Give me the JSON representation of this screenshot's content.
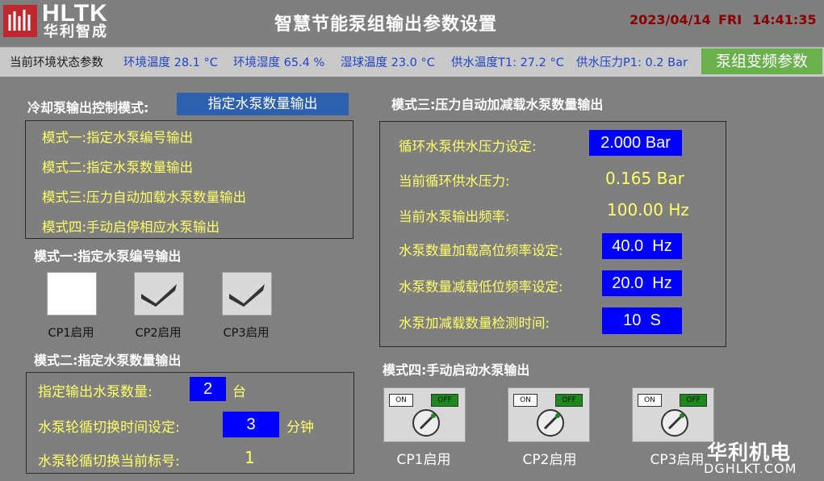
{
  "header": {
    "logo_text": "HLTK",
    "logo_cn": "华利智成",
    "title": "智慧节能泵组输出参数设置",
    "date": "2023/04/14",
    "weekday": "FRI",
    "time": "14:41:35"
  },
  "status": {
    "label": "当前环境状态参数",
    "items": [
      "环境温度 28.1 °C",
      "环境湿度 65.4 %",
      "湿球温度 23.0 °C",
      "供水温度T1: 27.2 °C",
      "供水压力P1: 0.2 Bar"
    ],
    "vfd_button": "泵组变频参数"
  },
  "control_mode": {
    "label": "冷却泵输出控制模式:",
    "selected": "指定水泵数量输出",
    "modes": [
      "模式一:指定水泵编号输出",
      "模式二:指定水泵数量输出",
      "模式三:压力自动加载水泵数量输出",
      "模式四:手动启停相应水泵输出"
    ]
  },
  "mode1": {
    "title": "模式一:指定水泵编号输出",
    "pumps": [
      {
        "label": "CP1启用",
        "checked": false
      },
      {
        "label": "CP2启用",
        "checked": true
      },
      {
        "label": "CP3启用",
        "checked": true
      }
    ]
  },
  "mode2": {
    "title": "模式二:指定水泵数量输出",
    "count_label": "指定输出水泵数量:",
    "count_value": "2",
    "count_unit": "台",
    "rotate_label": "水泵轮循切换时间设定:",
    "rotate_value": "3",
    "rotate_unit": "分钟",
    "current_label": "水泵轮循切换当前标号:",
    "current_value": "1"
  },
  "mode3": {
    "title": "模式三:压力自动加减载水泵数量输出",
    "rows": [
      {
        "label": "循环水泵供水压力设定:",
        "value": "2.000 Bar",
        "editable": true
      },
      {
        "label": "当前循环供水压力:",
        "value": "0.165 Bar",
        "editable": false
      },
      {
        "label": "当前水泵输出频率:",
        "value": "100.00 Hz",
        "editable": false
      },
      {
        "label": "水泵数量加载高位频率设定:",
        "value": "40.0  Hz",
        "editable": true
      },
      {
        "label": "水泵数量减载低位频率设定:",
        "value": "20.0  Hz",
        "editable": true
      },
      {
        "label": "水泵加减载数量检测时间:",
        "value": "10  S",
        "editable": true
      }
    ]
  },
  "mode4": {
    "title": "模式四:手动启动水泵输出",
    "switches": [
      {
        "label": "CP1启用",
        "on": "ON",
        "off": "OFF"
      },
      {
        "label": "CP2启用",
        "on": "ON",
        "off": "OFF"
      },
      {
        "label": "CP3启用",
        "on": "ON",
        "off": "OFF"
      }
    ]
  },
  "watermark": {
    "cn": "华利机电",
    "en": "DGHLKT.COM"
  },
  "colors": {
    "background": "#808080",
    "field_blue": "#0000ff",
    "text_yellow": "#ffff66",
    "status_value_blue": "#1f44c8",
    "vfd_green": "#6ab04c",
    "datetime_red": "#8b0000",
    "logo_red": "#c0282f"
  }
}
